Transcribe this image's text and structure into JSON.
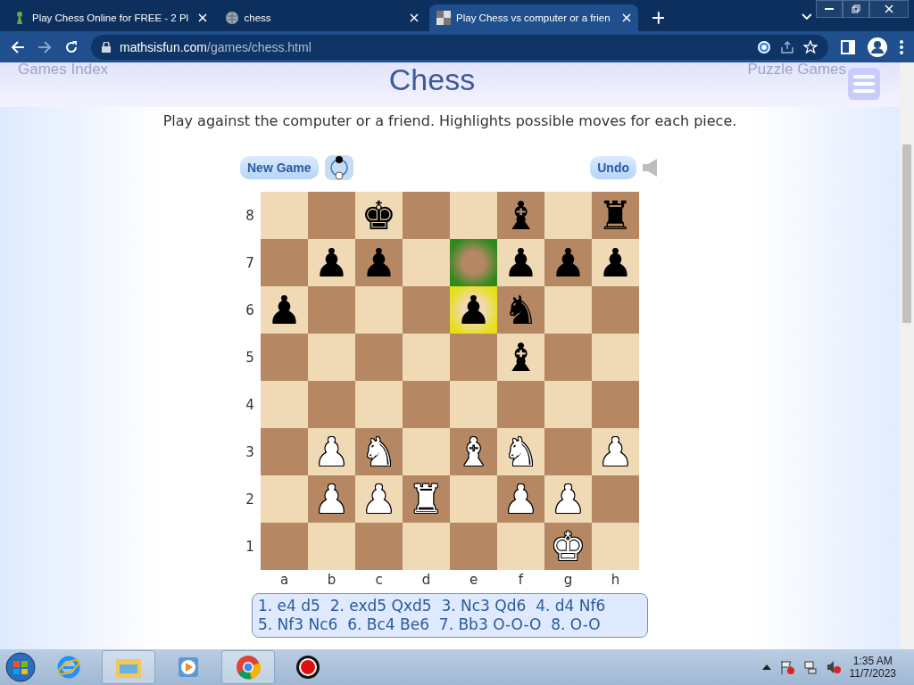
{
  "browser": {
    "tabs": [
      {
        "title": "Play Chess Online for FREE - 2 Pl",
        "selected": false
      },
      {
        "title": "chess",
        "selected": false
      },
      {
        "title": "Play Chess vs computer or a frien",
        "selected": true
      }
    ],
    "url": {
      "host": "mathsisfun.com",
      "path": "/games/chess.html"
    }
  },
  "header": {
    "left_link": "Games Index",
    "title": "Chess",
    "right_link": "Puzzle Games"
  },
  "intro": "Play against the computer or a friend. Highlights possible moves for each piece.",
  "controls": {
    "new_game": "New Game",
    "undo": "Undo"
  },
  "board": {
    "ranks": [
      {
        "label": "8",
        "cells": [
          {},
          {},
          {
            "piece": "♚",
            "white": false
          },
          {},
          {},
          {
            "piece": "♝",
            "white": false
          },
          {},
          {
            "piece": "♜",
            "white": false
          }
        ]
      },
      {
        "label": "7",
        "cells": [
          {},
          {
            "piece": "♟",
            "white": false
          },
          {
            "piece": "♟",
            "white": false
          },
          {},
          {
            "color": "#2f8a1d"
          },
          {
            "piece": "♟",
            "white": false
          },
          {
            "piece": "♟",
            "white": false
          },
          {
            "piece": "♟",
            "white": false
          }
        ]
      },
      {
        "label": "6",
        "cells": [
          {
            "piece": "♟",
            "white": false
          },
          {},
          {},
          {},
          {
            "piece": "♟",
            "white": false,
            "color": "#e6e01c"
          },
          {
            "piece": "♞",
            "white": false
          },
          {},
          {}
        ]
      },
      {
        "label": "5",
        "cells": [
          {},
          {},
          {},
          {},
          {},
          {
            "piece": "♝",
            "white": false
          },
          {},
          {}
        ]
      },
      {
        "label": "4",
        "cells": [
          {},
          {},
          {},
          {},
          {},
          {},
          {},
          {}
        ]
      },
      {
        "label": "3",
        "cells": [
          {},
          {
            "piece": "♟",
            "white": true
          },
          {
            "piece": "♞",
            "white": true
          },
          {},
          {
            "piece": "♝",
            "white": true
          },
          {
            "piece": "♞",
            "white": true
          },
          {},
          {
            "piece": "♟",
            "white": true
          }
        ]
      },
      {
        "label": "2",
        "cells": [
          {},
          {
            "piece": "♟",
            "white": true
          },
          {
            "piece": "♟",
            "white": true
          },
          {
            "piece": "♜",
            "white": true
          },
          {},
          {
            "piece": "♟",
            "white": true
          },
          {
            "piece": "♟",
            "white": true
          },
          {}
        ]
      },
      {
        "label": "1",
        "cells": [
          {},
          {},
          {},
          {},
          {},
          {},
          {
            "piece": "♚",
            "white": true
          },
          {}
        ]
      }
    ],
    "files": [
      "a",
      "b",
      "c",
      "d",
      "e",
      "f",
      "g",
      "h"
    ]
  },
  "moves": [
    "1. e4 d5  2. exd5 Qxd5  3. Nc3 Qd6  4. d4 Nf6",
    "5. Nf3 Nc6  6. Bc4 Be6  7. Bb3 O-O-O  8. O-O"
  ],
  "taskbar": {
    "time": "1:35 AM",
    "date": "11/7/2023"
  }
}
